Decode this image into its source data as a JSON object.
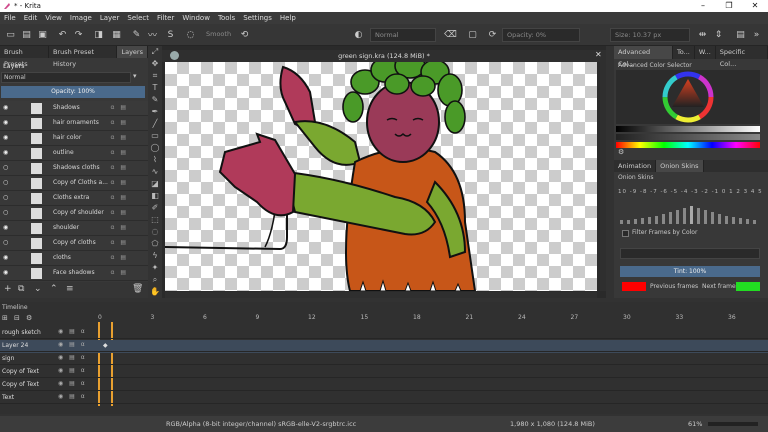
{
  "window": {
    "title": "* - Krita",
    "controls": [
      "–",
      "❐",
      "✕"
    ]
  },
  "menu": [
    "File",
    "Edit",
    "View",
    "Image",
    "Layer",
    "Select",
    "Filter",
    "Window",
    "Tools",
    "Settings",
    "Help"
  ],
  "toolbar": {
    "smooth_label": "Smooth",
    "blend_mode": "Normal",
    "opacity": "Opacity: 0%",
    "size": "Size: 10.37 px"
  },
  "left_dock": {
    "tabs": [
      "Brush Presets",
      "Brush Preset History",
      "Layers"
    ],
    "layers_title": "Layers",
    "blend_mode": "Normal",
    "opacity": "Opacity: 100%",
    "layers": [
      {
        "name": "Shadows",
        "visible": true
      },
      {
        "name": "hair ornaments",
        "visible": true
      },
      {
        "name": "hair color",
        "visible": true
      },
      {
        "name": "outline",
        "visible": true
      },
      {
        "name": "Shadows cloths",
        "visible": false
      },
      {
        "name": "Copy of Cloths a...",
        "visible": false
      },
      {
        "name": "Cloths extra",
        "visible": false
      },
      {
        "name": "Copy of shoulder",
        "visible": false
      },
      {
        "name": "shoulder",
        "visible": true
      },
      {
        "name": "Copy of cloths",
        "visible": false
      },
      {
        "name": "cloths",
        "visible": true
      },
      {
        "name": "Face shadows",
        "visible": true
      }
    ]
  },
  "document": {
    "tab": "green sign.kra (124.8 MiB) *"
  },
  "right_dock": {
    "top_tabs": [
      "Advanced Col...",
      "To...",
      "W...",
      "Specific Col..."
    ],
    "selector_title": "Advanced Color Selector",
    "mid_tabs": [
      "Animation",
      "Onion Skins"
    ],
    "onion_title": "Onion Skins",
    "onion_numbers": "10 -9 -8 -7 -6 -5 -4 -3 -2 -1  0  1  2  3  4  5  6  7  8  9 10",
    "filter_label": "Filter Frames by Color",
    "tint": "Tint: 100%",
    "previous_frames": "Previous frames",
    "next_frames": "Next frames",
    "prev_color": "#ff0000",
    "next_color": "#22dd22"
  },
  "timeline": {
    "title": "Timeline",
    "ticks": [
      "0",
      "3",
      "6",
      "9",
      "12",
      "15",
      "18",
      "21",
      "24",
      "27",
      "30",
      "33",
      "36"
    ],
    "rows": [
      "rough sketch",
      "Layer 24",
      "sign",
      "Copy of Text",
      "Copy of Text",
      "Text"
    ]
  },
  "status": {
    "color_profile": "RGB/Alpha (8-bit integer/channel)  sRGB-elle-V2-srgbtrc.icc",
    "dimensions": "1,980 x 1,080 (124.8 MiB)",
    "zoom": "61%"
  }
}
